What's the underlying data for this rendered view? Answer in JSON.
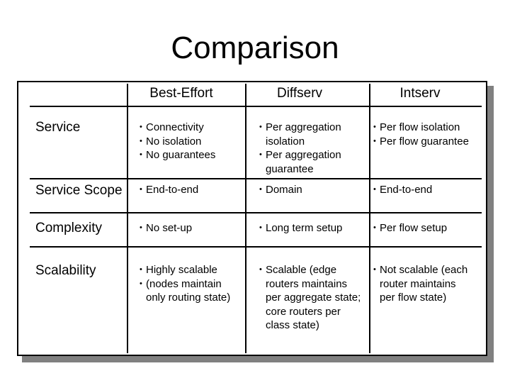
{
  "title": "Comparison",
  "columns": [
    "Best-Effort",
    "Diffserv",
    "Intserv"
  ],
  "rows": [
    {
      "label": "Service",
      "cells": [
        [
          "Connectivity",
          "No isolation",
          "No guarantees"
        ],
        [
          "Per aggregation\nisolation",
          "Per aggregation\nguarantee"
        ],
        [
          "Per flow isolation",
          "Per flow guarantee"
        ]
      ]
    },
    {
      "label": "Service Scope",
      "cells": [
        [
          "End-to-end"
        ],
        [
          "Domain"
        ],
        [
          "End-to-end"
        ]
      ]
    },
    {
      "label": "Complexity",
      "cells": [
        [
          "No set-up"
        ],
        [
          "Long term setup"
        ],
        [
          "Per flow setup"
        ]
      ]
    },
    {
      "label": "Scalability",
      "cells": [
        [
          "Highly scalable",
          "(nodes maintain\nonly routing state)"
        ],
        [
          "Scalable (edge\nrouters maintains\nper aggregate state;\ncore routers per\nclass state)"
        ],
        [
          "Not scalable (each\nrouter maintains\nper flow state)"
        ]
      ]
    }
  ]
}
